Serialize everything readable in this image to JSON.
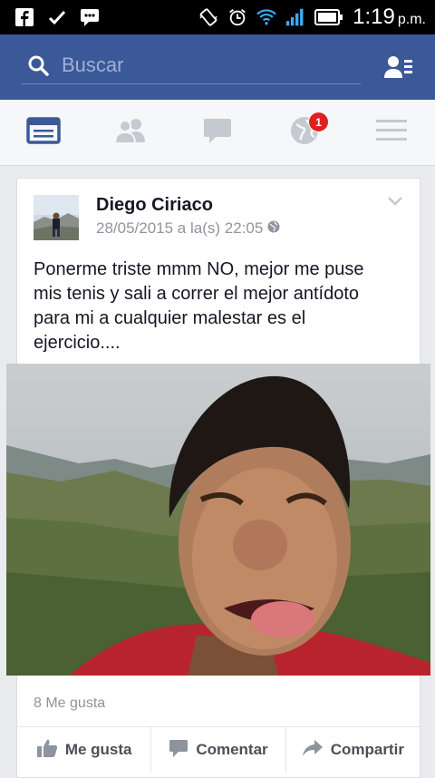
{
  "status_bar": {
    "time": "1:19",
    "ampm": "p.m.",
    "icons": [
      "facebook-icon",
      "checkmark-icon",
      "messenger-icon",
      "vibrate-icon",
      "alarm-icon",
      "wifi-icon",
      "signal-icon",
      "battery-icon"
    ]
  },
  "search": {
    "placeholder": "Buscar"
  },
  "tabs": [
    "news-feed-tab",
    "friends-tab",
    "messages-tab",
    "notifications-tab",
    "more-menu-tab"
  ],
  "notifications": {
    "badge": "1"
  },
  "colors": {
    "brand": "#3b5998",
    "active_tab": "#3b5998",
    "inactive_tab": "#c5c9d0",
    "badge": "#e02020"
  },
  "post": {
    "author": "Diego Ciriaco",
    "timestamp": "28/05/2015 a la(s) 22:05",
    "text": "Ponerme triste mmm NO, mejor  me puse mis tenis y sali a correr el mejor antídoto para mi a cualquier malestar es el ejercicio....",
    "likes": "8 Me gusta",
    "actions": {
      "like": "Me gusta",
      "comment": "Comentar",
      "share": "Compartir"
    }
  }
}
